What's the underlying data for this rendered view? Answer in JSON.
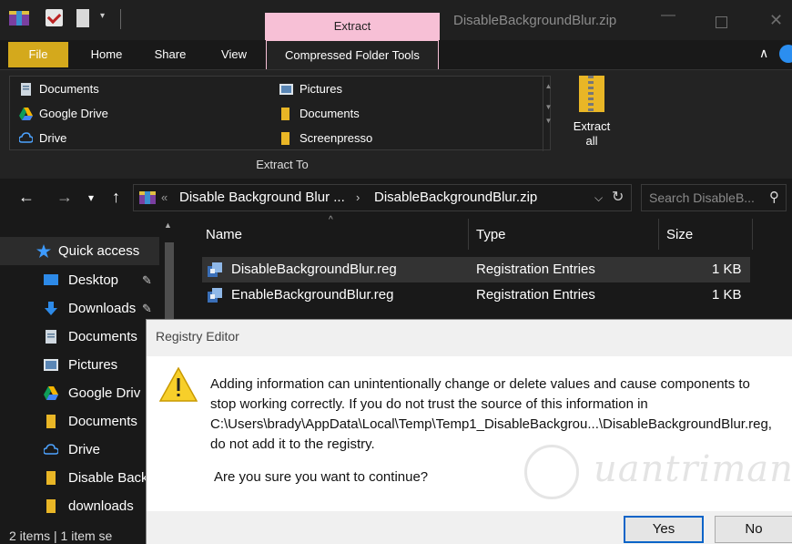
{
  "titlebar": {
    "context_tab": "Extract",
    "window_title": "DisableBackgroundBlur.zip",
    "minimize_glyph": "—",
    "close_glyph": "✕",
    "dropdown_glyph": "▾"
  },
  "ribbon": {
    "tabs": {
      "file": "File",
      "home": "Home",
      "share": "Share",
      "view": "View",
      "compressed": "Compressed Folder Tools"
    },
    "collapse_glyph": "∧",
    "extract_to": {
      "group_label": "Extract To",
      "left": [
        "Documents",
        "Google Drive",
        "Drive"
      ],
      "right": [
        "Pictures",
        "Documents",
        "Screenpresso"
      ]
    },
    "extract_all": {
      "line1": "Extract",
      "line2": "all"
    }
  },
  "address": {
    "back_glyph": "←",
    "forward_glyph": "→",
    "recent_glyph": "▾",
    "up_glyph": "↑",
    "sep_glyph": "«",
    "crumbs": [
      "Disable Background Blur ...",
      "DisableBackgroundBlur.zip"
    ],
    "chevron_glyph": "›",
    "dropdown_glyph": "⌵",
    "refresh_glyph": "↻",
    "search_placeholder": "Search DisableB...",
    "search_glyph": "⚲"
  },
  "navpane": {
    "quick_access": "Quick access",
    "items": [
      {
        "label": "Desktop",
        "pin": "✎"
      },
      {
        "label": "Downloads",
        "pin": "✎"
      },
      {
        "label": "Documents",
        "pin": ""
      },
      {
        "label": "Pictures",
        "pin": ""
      },
      {
        "label": "Google Driv",
        "pin": ""
      },
      {
        "label": "Documents",
        "pin": ""
      },
      {
        "label": "Drive",
        "pin": ""
      },
      {
        "label": "Disable Back",
        "pin": ""
      },
      {
        "label": "downloads",
        "pin": ""
      }
    ]
  },
  "filelist": {
    "columns": {
      "name": "Name",
      "type": "Type",
      "size": "Size"
    },
    "sort_glyph": "^",
    "rows": [
      {
        "name": "DisableBackgroundBlur.reg",
        "type": "Registration Entries",
        "size": "1 KB"
      },
      {
        "name": "EnableBackgroundBlur.reg",
        "type": "Registration Entries",
        "size": "1 KB"
      }
    ]
  },
  "statusbar": {
    "text": "2 items  |  1 item se"
  },
  "dialog": {
    "title": "Registry Editor",
    "message_lines": [
      "Adding information can unintentionally change or delete values and cause components to",
      "stop working correctly. If you do not trust the source of this information in",
      "C:\\Users\\brady\\AppData\\Local\\Temp\\Temp1_DisableBackgrou...\\DisableBackgroundBlur.reg,",
      "do not add it to the registry."
    ],
    "question": "Are you sure you want to continue?",
    "yes": "Yes",
    "no": "No"
  },
  "watermark": {
    "text": "uantrimang"
  },
  "colors": {
    "file_tab": "#d4a91c",
    "context_tab": "#f7c0d6",
    "accent_blue": "#0a64c8",
    "folder_yellow": "#e9b626"
  }
}
